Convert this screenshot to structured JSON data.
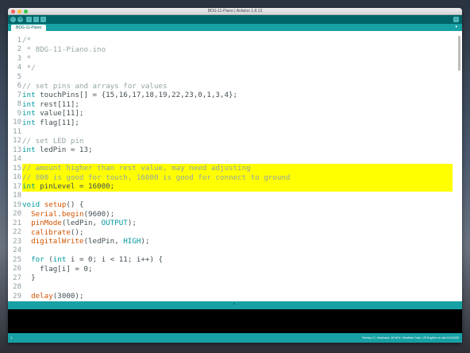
{
  "window": {
    "title": "BDG-11-Piano | Arduino 1.8.13"
  },
  "toolbar": {
    "verify_icon": "check-icon",
    "upload_icon": "arrow-right-icon",
    "new_icon": "new-file-icon",
    "open_icon": "arrow-up-icon",
    "save_icon": "arrow-down-icon",
    "serial_icon": "magnifier-icon",
    "verify_glyph": "✓",
    "upload_glyph": "➔",
    "new_glyph": "▫",
    "open_glyph": "↑",
    "save_glyph": "↓",
    "serial_glyph": "⌕"
  },
  "tabs": {
    "active": "BDG-11-Piano",
    "menu_glyph": "▾"
  },
  "editor": {
    "lines": [
      {
        "n": "1",
        "text": "/*"
      },
      {
        "n": "2",
        "text": " * 8DG-11-Piano.ino"
      },
      {
        "n": "3",
        "text": " *"
      },
      {
        "n": "4",
        "text": " */"
      },
      {
        "n": "5",
        "text": ""
      },
      {
        "n": "6",
        "text": "// set pins and arrays for values"
      },
      {
        "n": "7",
        "text": "int touchPins[] = {15,16,17,18,19,22,23,0,1,3,4};"
      },
      {
        "n": "8",
        "text": "int rest[11];"
      },
      {
        "n": "9",
        "text": "int value[11];"
      },
      {
        "n": "10",
        "text": "int flag[11];"
      },
      {
        "n": "11",
        "text": ""
      },
      {
        "n": "12",
        "text": "// set LED pin"
      },
      {
        "n": "13",
        "text": "int ledPin = 13;"
      },
      {
        "n": "14",
        "text": ""
      },
      {
        "n": "15",
        "text": "// amount higher than rest value, may need adjusting"
      },
      {
        "n": "16",
        "text": "// 800 is good for touch, 16000 is good for connect to ground"
      },
      {
        "n": "17",
        "text": "int pinLevel = 16000;"
      },
      {
        "n": "18",
        "text": ""
      },
      {
        "n": "19",
        "text": "void setup() {"
      },
      {
        "n": "20",
        "text": "  Serial.begin(9600);"
      },
      {
        "n": "21",
        "text": "  pinMode(ledPin, OUTPUT);"
      },
      {
        "n": "22",
        "text": "  calibrate();"
      },
      {
        "n": "23",
        "text": "  digitalWrite(ledPin, HIGH);"
      },
      {
        "n": "24",
        "text": ""
      },
      {
        "n": "25",
        "text": "  for (int i = 0; i < 11; i++) {"
      },
      {
        "n": "26",
        "text": "    flag[i] = 0;"
      },
      {
        "n": "27",
        "text": "  }"
      },
      {
        "n": "28",
        "text": ""
      },
      {
        "n": "29",
        "text": "  delay(3000);"
      },
      {
        "n": "30",
        "text": ""
      },
      {
        "n": "31",
        "text": "}"
      }
    ],
    "highlighted_lines": [
      "15",
      "16",
      "17"
    ],
    "highlight_color": "#ffff00"
  },
  "status": {
    "line_number": "1",
    "board": "Teensy LC, Keyboard, 48 MHz, Smallest Code, US English on usb:14111000"
  },
  "colors": {
    "toolbar": "#006468",
    "tabbar": "#17a1a5",
    "comment": "#95a5a6",
    "keyword": "#00979c",
    "function": "#d35400"
  }
}
